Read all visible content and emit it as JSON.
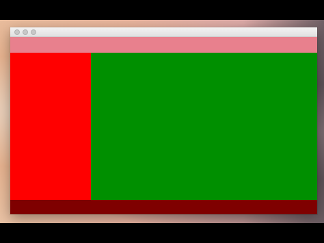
{
  "window": {
    "title": "",
    "controls": [
      {
        "name": "close",
        "color": "#c8c8c8"
      },
      {
        "name": "minimize",
        "color": "#c8c8c8"
      },
      {
        "name": "maximize",
        "color": "#c8c8c8"
      }
    ]
  },
  "layout_colors": {
    "header": "#e8808d",
    "sidebar": "#ff0000",
    "content": "#008f00",
    "footer": "#7f0000"
  }
}
